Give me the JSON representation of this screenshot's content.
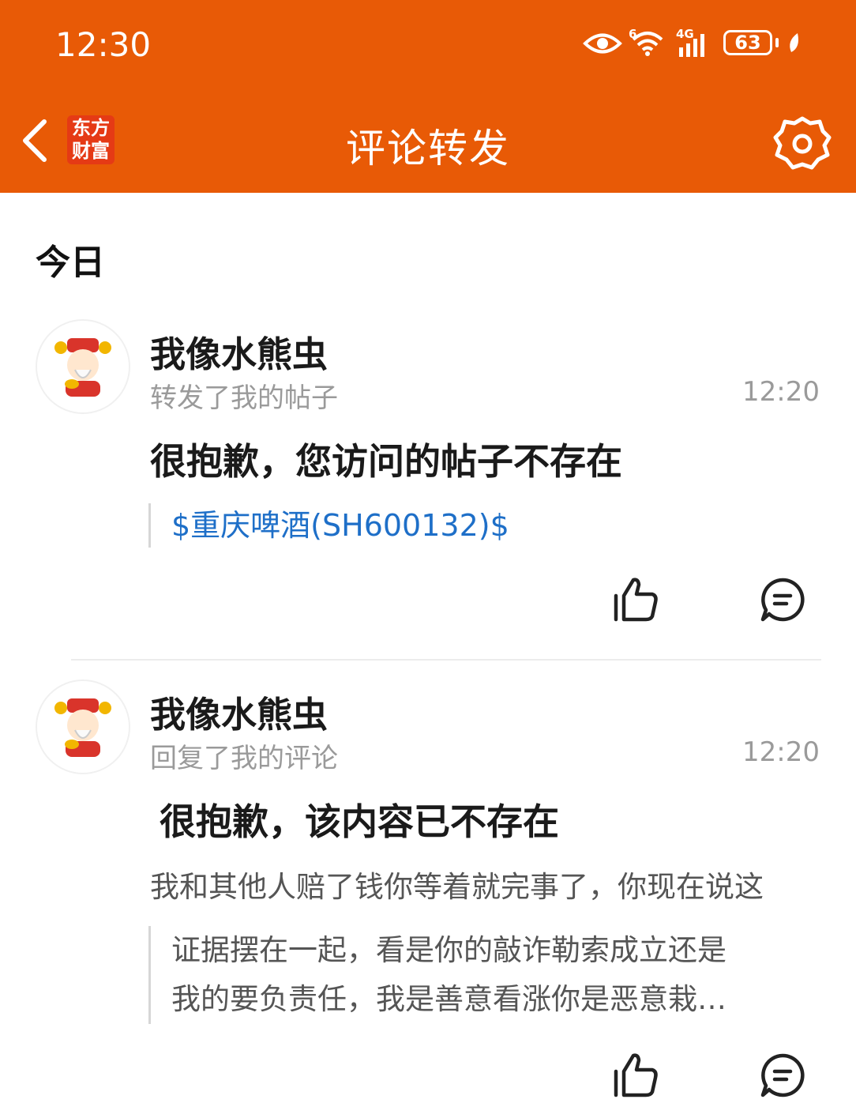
{
  "status_bar": {
    "time": "12:30",
    "battery": "63",
    "network": "4G",
    "wifi_badge": "6"
  },
  "header": {
    "title": "评论转发",
    "logo_line1": "东方",
    "logo_line2": "财富",
    "brand_color": "#e85a06"
  },
  "section": {
    "title": "今日"
  },
  "items": [
    {
      "user": "我像水熊虫",
      "action": "转发了我的帖子",
      "time": "12:20",
      "main": "很抱歉，您访问的帖子不存在",
      "quote": "$重庆啤酒(SH600132)$"
    },
    {
      "user": "我像水熊虫",
      "action": "回复了我的评论",
      "time": "12:20",
      "main": "很抱歉，该内容已不存在",
      "comment": "我和其他人赔了钱你等着就完事了，你现在说这",
      "quote_line1": "证据摆在一起，看是你的敲诈勒索成立还是",
      "quote_line2": "我的要负责任，我是善意看涨你是恶意栽…"
    }
  ],
  "icons": {
    "back": "chevron-left-icon",
    "settings": "gear-icon",
    "like": "thumbs-up-icon",
    "reply": "comment-icon",
    "eye": "eye-icon",
    "wifi": "wifi-icon",
    "signal": "signal-icon"
  }
}
